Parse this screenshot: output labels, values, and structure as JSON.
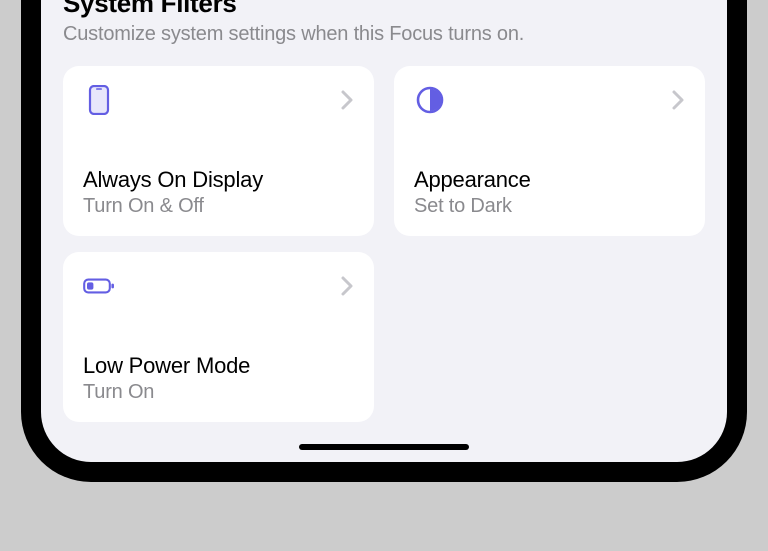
{
  "accent": "#635ee3",
  "header": {
    "title": "System Filters",
    "subtitle": "Customize system settings when this Focus turns on."
  },
  "cards": [
    {
      "icon": "phone",
      "title": "Always On Display",
      "subtitle": "Turn On & Off"
    },
    {
      "icon": "contrast",
      "title": "Appearance",
      "subtitle": "Set to Dark"
    },
    {
      "icon": "battery",
      "title": "Low Power Mode",
      "subtitle": "Turn On"
    }
  ]
}
